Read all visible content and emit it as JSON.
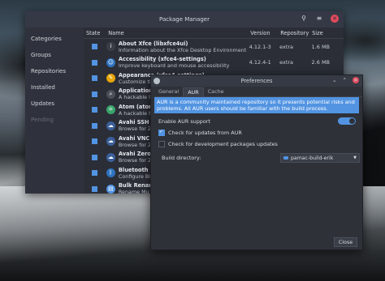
{
  "window": {
    "title": "Package Manager"
  },
  "sidebar": {
    "items": [
      {
        "label": "Categories"
      },
      {
        "label": "Groups"
      },
      {
        "label": "Repositories"
      },
      {
        "label": "Installed"
      },
      {
        "label": "Updates"
      },
      {
        "label": "Pending"
      }
    ]
  },
  "table": {
    "headers": {
      "state": "State",
      "name": "Name",
      "version": "Version",
      "repository": "Repository",
      "size": "Size"
    },
    "rows": [
      {
        "name": "About Xfce  (libxfce4ui)",
        "desc": "Information about the Xfce Desktop Environment",
        "version": "4.12.1-3",
        "repo": "extra",
        "size": "1.6 MB",
        "icon": "info-icon",
        "color": "#3a3e47"
      },
      {
        "name": "Accessibility  (xfce4-settings)",
        "desc": "Improve keyboard and mouse accessibility",
        "version": "4.12.4-1",
        "repo": "extra",
        "size": "2.6 MB",
        "icon": "accessibility-icon",
        "color": "#2e74c0"
      },
      {
        "name": "Appearance  (xfce4-settings)",
        "desc": "Customize th",
        "version": "",
        "repo": "",
        "size": "",
        "icon": "appearance-icon",
        "color": "#e5a50a"
      },
      {
        "name": "Application",
        "desc": "A hackable te",
        "version": "",
        "repo": "",
        "size": "",
        "icon": "app-finder-icon",
        "color": "#4a4f5a"
      },
      {
        "name": "Atom  (atom",
        "desc": "A hackable te",
        "version": "",
        "repo": "",
        "size": "",
        "icon": "atom-icon",
        "color": "#3aa56b"
      },
      {
        "name": "Avahi SSH S",
        "desc": "Browse for Z",
        "version": "",
        "repo": "",
        "size": "",
        "icon": "avahi-ssh-icon",
        "color": "#3a5f9a"
      },
      {
        "name": "Avahi VNC S",
        "desc": "Browse for Z",
        "version": "",
        "repo": "",
        "size": "",
        "icon": "avahi-vnc-icon",
        "color": "#3a5f9a"
      },
      {
        "name": "Avahi Zeroc",
        "desc": "Browse for Z",
        "version": "",
        "repo": "",
        "size": "",
        "icon": "avahi-zeroconf-icon",
        "color": "#3a5f9a"
      },
      {
        "name": "Bluetooth  (",
        "desc": "Configure Bl",
        "version": "",
        "repo": "",
        "size": "",
        "icon": "bluetooth-icon",
        "color": "#2e74c0"
      },
      {
        "name": "Bulk Renam",
        "desc": "Rename Mu",
        "version": "",
        "repo": "",
        "size": "",
        "icon": "bulk-rename-icon",
        "color": "#5294e2"
      }
    ]
  },
  "preferences": {
    "title": "Preferences",
    "tabs": [
      "General",
      "AUR",
      "Cache"
    ],
    "active_tab": "AUR",
    "info": "AUR is a community maintained repository so it presents potential risks and problems. All AUR users should be familiar with the build process.",
    "enable_aur_label": "Enable AUR support",
    "enable_aur": true,
    "check_updates_label": "Check for updates from AUR",
    "check_updates": true,
    "check_dev_label": "Check for development packages updates",
    "check_dev": false,
    "build_dir_label": "Build directory:",
    "build_dir_value": "pamac-build-erik",
    "close_label": "Close"
  },
  "colors": {
    "accent": "#5294e2",
    "close": "#e14a5c"
  }
}
